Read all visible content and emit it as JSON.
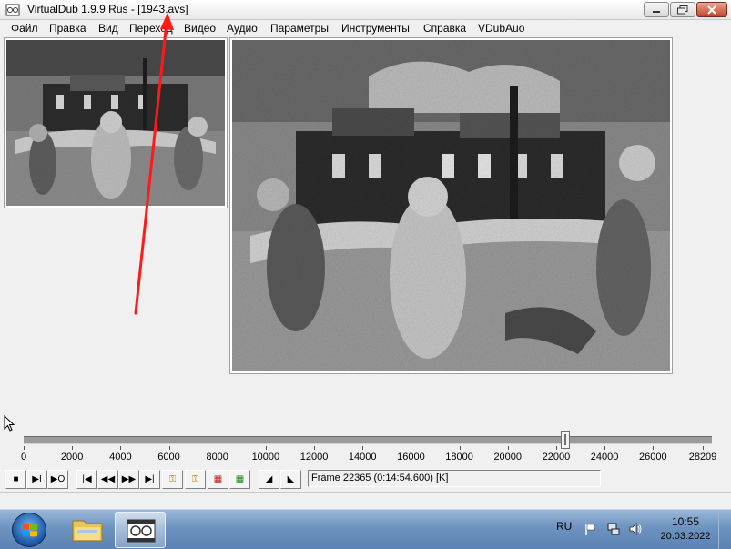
{
  "window": {
    "title": "VirtualDub 1.9.9 Rus - [1943.avs]"
  },
  "menu": {
    "items": [
      "Файл",
      "Правка",
      "Вид",
      "Переход",
      "Видео",
      "Аудио",
      "Параметры",
      "Инструменты",
      "Справка",
      "VDubAuo"
    ]
  },
  "timeline": {
    "min": 0,
    "max": 28209,
    "current_frame": 22365,
    "ticks": [
      "0",
      "2000",
      "4000",
      "6000",
      "8000",
      "10000",
      "12000",
      "14000",
      "16000",
      "18000",
      "20000",
      "22000",
      "24000",
      "26000",
      "28209"
    ]
  },
  "toolbar": {
    "buttons": [
      {
        "name": "stop-icon",
        "glyph": "■"
      },
      {
        "name": "play-input-icon",
        "glyph": "▶I"
      },
      {
        "name": "play-output-icon",
        "glyph": "▶O"
      },
      {
        "name": "go-start-icon",
        "glyph": "|◀"
      },
      {
        "name": "prev-frame-icon",
        "glyph": "◀◀"
      },
      {
        "name": "next-frame-icon",
        "glyph": "▶▶"
      },
      {
        "name": "go-end-icon",
        "glyph": "▶|"
      },
      {
        "name": "prev-keyframe-icon",
        "glyph": "⚿"
      },
      {
        "name": "next-keyframe-icon",
        "glyph": "⚿"
      },
      {
        "name": "prev-scene-icon",
        "glyph": "▦"
      },
      {
        "name": "next-scene-icon",
        "glyph": "▦"
      },
      {
        "name": "mark-in-icon",
        "glyph": "◢"
      },
      {
        "name": "mark-out-icon",
        "glyph": "◣"
      }
    ],
    "frame_status": "Frame 22365 (0:14:54.600) [K]"
  },
  "taskbar": {
    "language": "RU",
    "time": "10:55",
    "date": "20.03.2022"
  },
  "colors": {
    "annotation_arrow": "#ff1a1a",
    "taskbar": "#6d93c0"
  }
}
